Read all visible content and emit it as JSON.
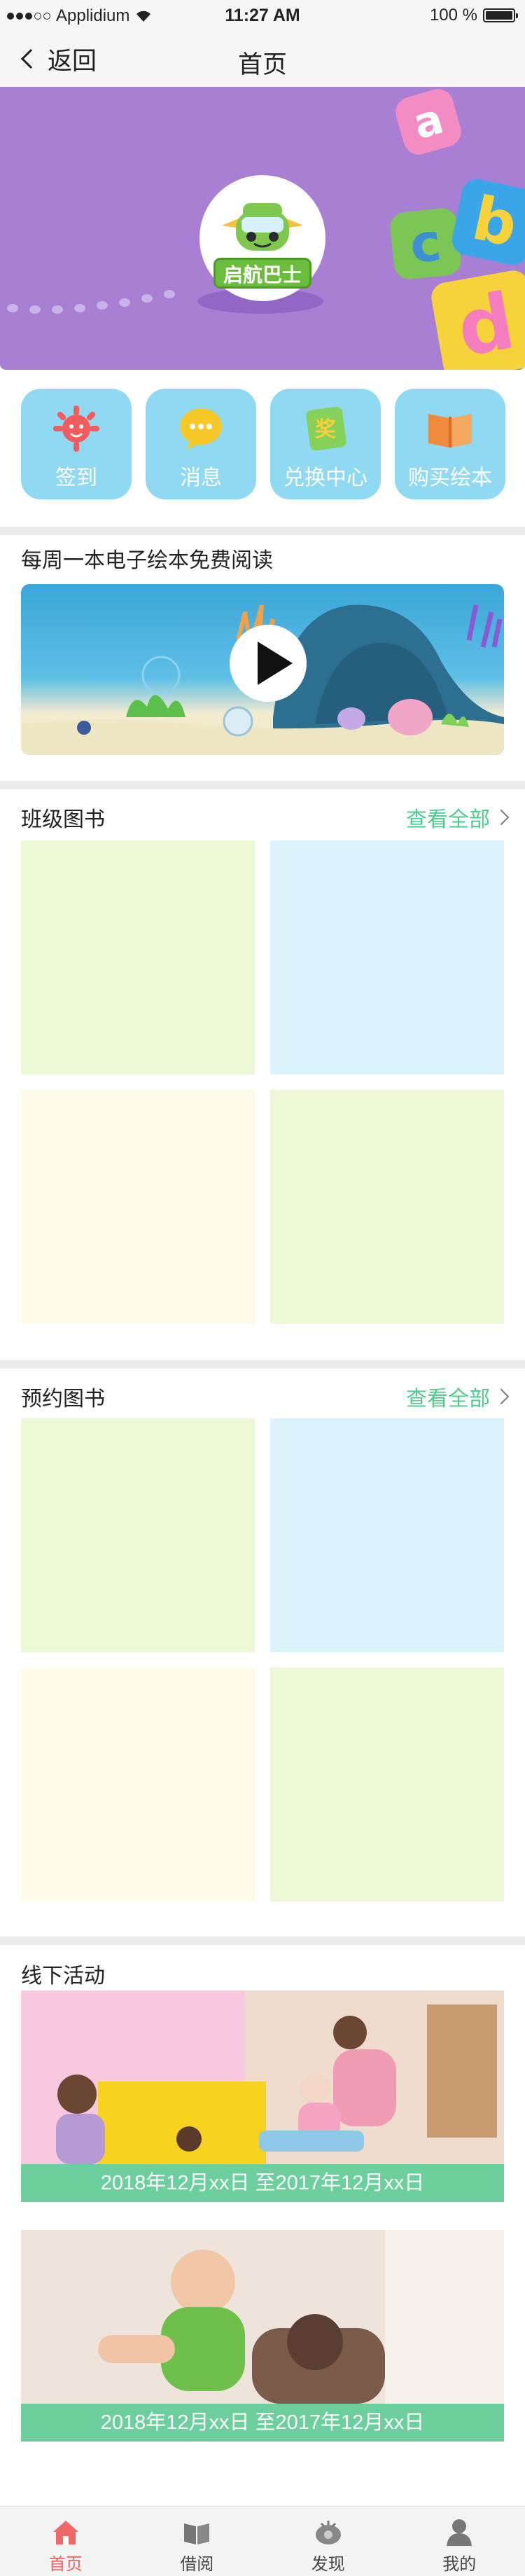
{
  "status_bar": {
    "carrier": "Applidium",
    "time": "11:27 AM",
    "battery": "100 %"
  },
  "nav": {
    "back_label": "返回",
    "title": "首页"
  },
  "banner": {
    "logo_text": "启航巴士",
    "letters": [
      "a",
      "c",
      "b",
      "d"
    ],
    "pager_count": 4,
    "active_index": 0
  },
  "quick_actions": [
    {
      "label": "签到",
      "icon": "sun-face-icon"
    },
    {
      "label": "消息",
      "icon": "chat-bubble-icon"
    },
    {
      "label": "兑换中心",
      "icon": "prize-card-icon"
    },
    {
      "label": "购买绘本",
      "icon": "open-book-icon"
    }
  ],
  "quick_action_glyph": "奖",
  "weekly": {
    "title": "每周一本电子绘本免费阅读"
  },
  "class_books": {
    "title": "班级图书",
    "see_all": "查看全部"
  },
  "reserved_books": {
    "title": "预约图书",
    "see_all": "查看全部"
  },
  "offline": {
    "title": "线下活动",
    "activities": [
      {
        "date_range": "2018年12月xx日  至2017年12月xx日"
      },
      {
        "date_range": "2018年12月xx日  至2017年12月xx日"
      }
    ]
  },
  "tab_bar": [
    {
      "label": "首页",
      "icon": "home-icon",
      "active": true
    },
    {
      "label": "借阅",
      "icon": "book-icon",
      "active": false
    },
    {
      "label": "发现",
      "icon": "discover-icon",
      "active": false
    },
    {
      "label": "我的",
      "icon": "person-icon",
      "active": false
    }
  ],
  "colors": {
    "banner": "#a97fd4",
    "quick_action_bg": "#8fd9f2",
    "accent_green": "#4ccb8e",
    "activity_bar": "#6dcf9e",
    "tab_active": "#ee5f5f"
  }
}
